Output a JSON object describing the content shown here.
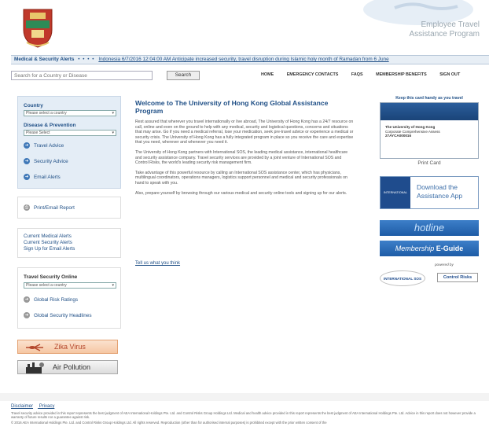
{
  "header": {
    "program_title_1": "Employee Travel",
    "program_title_2": "Assistance Program"
  },
  "alerts": {
    "label": "Medical & Security Alerts",
    "message": "Indonesia 6/7/2016 12:04:00 AM Anticipate increased security, travel disruption during Islamic holy month of Ramadan from 6 June"
  },
  "search": {
    "placeholder": "Search for a Country or Disease",
    "button": "Search"
  },
  "nav": [
    "HOME",
    "EMERGENCY CONTACTS",
    "FAQS",
    "MEMBERSHIP BENEFITS",
    "SIGN OUT"
  ],
  "sidebar": {
    "country_label": "Country",
    "country_select": "Please select a country",
    "disease_label": "Disease & Prevention",
    "disease_select": "Please Select",
    "links": [
      "Travel Advice",
      "Security Advice",
      "Email Alerts"
    ],
    "print_email": "Print/Email Report",
    "alerts_links": [
      "Current Medical Alerts",
      "Current Security Alerts",
      "Sign Up for Email Alerts"
    ],
    "travel_security": "Travel Security Online",
    "ts_select": "Please select a country",
    "ts_links": [
      "Global Risk Ratings",
      "Global Security Headlines"
    ]
  },
  "banners": {
    "zika": "Zika Virus",
    "pollution": "Air Pollution"
  },
  "main": {
    "welcome": "Welcome to The University of Hong Kong Global Assistance Program",
    "p1": "Rest assured that wherever you travel internationally or live abroad, The University of Hong Kong has a 24/7 resource on call, online and even on the ground to help with any medical, security and logistical questions, concerns and situations that may arise. Go if you need a medical referral, lose your medication, seek pre-travel advice or experience a medical or security crisis. The University of Hong Kong has a fully integrated program in place so you receive the care and expertise that you need, wherever and whenever you need it.",
    "p2": "The University of Hong Kong partners with International SOS, the leading medical assistance, international healthcare and security assistance company. Travel security services are provided by a joint venture of International SOS and Control Risks, the world's leading security risk management firm.",
    "p3": "Take advantage of this powerful resource by calling an International SOS assistance center, which has physicians, multilingual coordinators, operations managers, logistics support personnel and medical and security professionals on hand to speak with you.",
    "p4": "Also, prepare yourself by browsing through our various medical and security online tools and signing up for our alerts.",
    "tell": "Tell us what you think"
  },
  "right": {
    "keep_card": "Keep this card handy as you travel",
    "card_lines": [
      "The University of Hong Kong",
      "Corporate Comprehensive Assess",
      "27AYCA000016"
    ],
    "print_card": "Print Card",
    "download_1": "Download the",
    "download_2": "Assistance App",
    "download_logo": "INTERNATIONAL SOS",
    "hotline": "hotline",
    "guide_1": "Membership",
    "guide_2": "E-Guide",
    "powered": "powered by",
    "intsos": "INTERNATIONAL SOS",
    "control": "Control Risks"
  },
  "footer": {
    "links": [
      "Disclaimer",
      "Privacy"
    ],
    "text": "Travel security advice provided in this report represents the best judgment of AEA International Holdings Pte. Ltd. and Control Risks Group Holdings Ltd. Medical and health advice provided in this report represents the best judgment of AEA International Holdings Pte. Ltd. Advice in this report does not however provide a warranty of future results nor a guarantee against risk.",
    "copy": "© 2016 AEA International Holdings Pte. Ltd. and Control Risks Group Holdings Ltd. All rights reserved. Reproduction (other than for authorised internal purposes) is prohibited except with the prior written consent of the"
  },
  "colors": {
    "accent": "#1f4f86",
    "sidebar_bg": "#e4edf6",
    "hotline": "#2a6bb6",
    "zika": "#f6c7a3"
  }
}
